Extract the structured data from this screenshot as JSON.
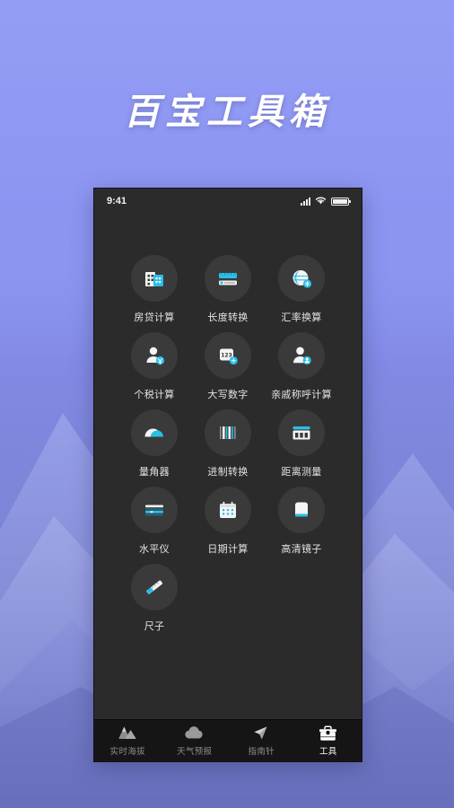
{
  "poster": {
    "title": "百宝工具箱",
    "bg_top_color": "#8b95f0",
    "bg_bottom_color": "#6f77c2"
  },
  "phone": {
    "screen_bg": "#2b2b2b",
    "accent_color": "#29bfe8"
  },
  "status_bar": {
    "time": "9:41",
    "signal_icon": "cellular-signal-icon",
    "wifi_icon": "wifi-icon",
    "battery_icon": "battery-full-icon"
  },
  "apps": [
    {
      "label": "房贷计算",
      "icon": "buildings-icon"
    },
    {
      "label": "长度转换",
      "icon": "length-bars-icon"
    },
    {
      "label": "汇率换算",
      "icon": "currency-globe-icon"
    },
    {
      "label": "个税计算",
      "icon": "person-tax-icon"
    },
    {
      "label": "大写数字",
      "icon": "number-card-icon"
    },
    {
      "label": "亲戚称呼计算",
      "icon": "person-relative-icon"
    },
    {
      "label": "量角器",
      "icon": "protractor-icon"
    },
    {
      "label": "进制转换",
      "icon": "base-bars-icon"
    },
    {
      "label": "距离测量",
      "icon": "rangefinder-icon"
    },
    {
      "label": "水平仪",
      "icon": "spirit-level-icon"
    },
    {
      "label": "日期计算",
      "icon": "calendar-icon"
    },
    {
      "label": "高清镜子",
      "icon": "mirror-icon"
    },
    {
      "label": "尺子",
      "icon": "ruler-icon"
    }
  ],
  "tabs": [
    {
      "label": "实时海拔",
      "icon": "mountain-icon",
      "active": false
    },
    {
      "label": "天气预报",
      "icon": "cloud-icon",
      "active": false
    },
    {
      "label": "指南针",
      "icon": "compass-icon",
      "active": false
    },
    {
      "label": "工具",
      "icon": "toolbox-icon",
      "active": true
    }
  ]
}
